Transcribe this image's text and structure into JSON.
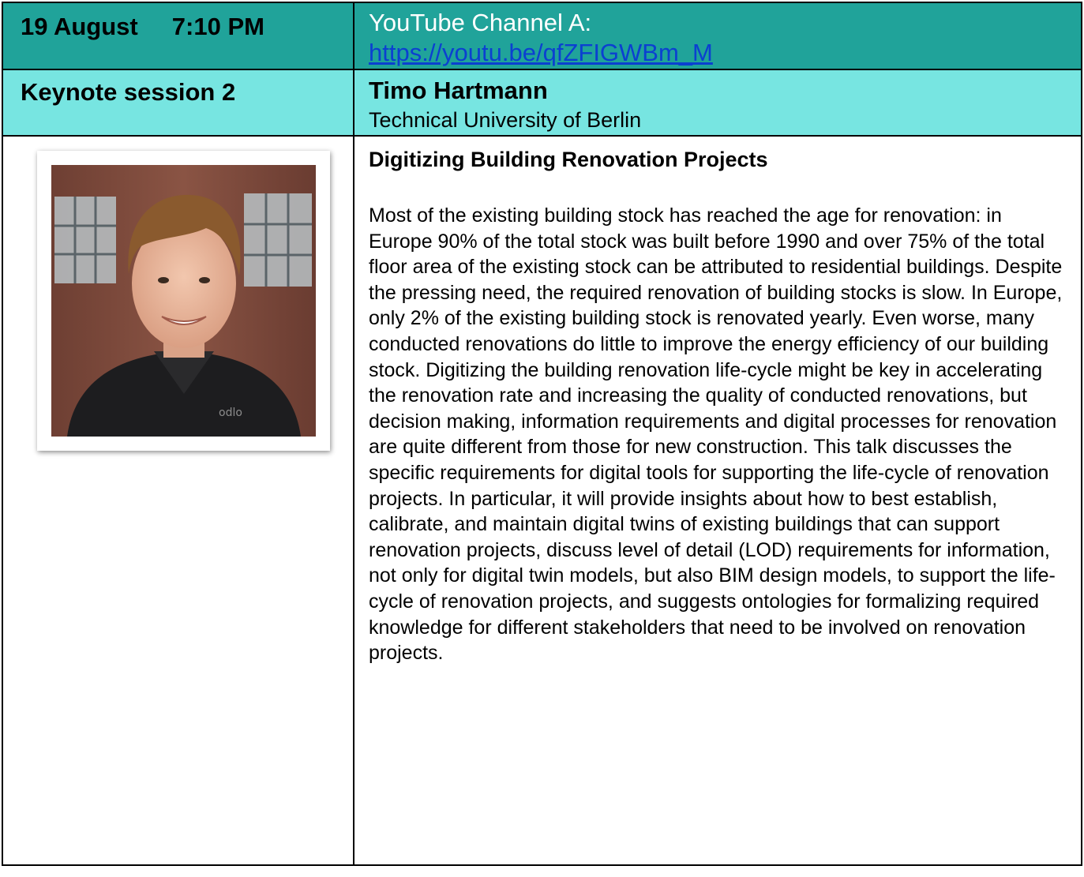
{
  "header": {
    "date": "19 August",
    "time": "7:10 PM",
    "channel_label": "YouTube Channel A:",
    "channel_url": "https://youtu.be/qfZFIGWBm_M"
  },
  "session": {
    "name": "Keynote session 2",
    "speaker": "Timo Hartmann",
    "affiliation": "Technical University of Berlin"
  },
  "talk": {
    "title": "Digitizing Building Renovation Projects",
    "abstract": "Most of the existing building stock has reached the age for renovation: in Europe 90% of the total stock was built before 1990 and over 75% of the total floor area of the existing stock can be attributed to residential buildings. Despite the pressing need, the required renovation of building stocks is slow. In Europe, only 2% of the existing building stock is renovated yearly. Even worse, many conducted renovations do little to improve the energy efficiency of our building stock. Digitizing the building renovation life-cycle might be key in accelerating the renovation rate and increasing the quality of conducted renovations, but decision making, information requirements and digital processes for renovation are quite different from those for new construction. This talk discusses the specific requirements for digital tools for supporting the life-cycle of renovation projects. In particular, it will provide insights about how to best establish, calibrate, and maintain digital twins of existing buildings that can support renovation projects, discuss level of detail (LOD) requirements for information, not only for digital twin models, but also BIM design models, to support the life-cycle of renovation projects, and suggests ontologies for formalizing required knowledge for different stakeholders that need to be involved on renovation projects."
  },
  "colors": {
    "header_teal": "#20a39a",
    "sub_cyan": "#77e5e1",
    "link_blue": "#0b40d1"
  }
}
